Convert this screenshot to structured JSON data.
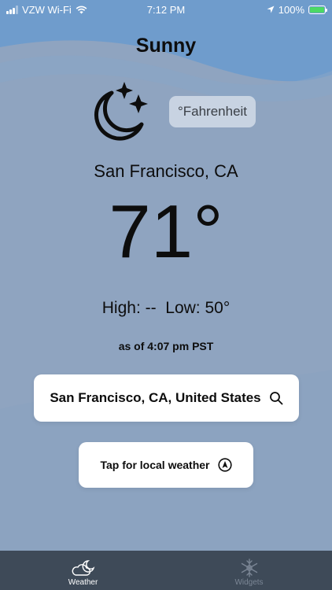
{
  "status_bar": {
    "carrier": "VZW Wi-Fi",
    "time": "7:12 PM",
    "battery": "100%"
  },
  "weather": {
    "condition": "Sunny",
    "unit_toggle": "°Fahrenheit",
    "city": "San Francisco, CA",
    "temperature": "71°",
    "high_low": "High: --  Low: 50°",
    "as_of": "as of 4:07 pm PST",
    "icon": "moon-stars-icon"
  },
  "search": {
    "location": "San Francisco, CA, United States",
    "icon": "search-icon"
  },
  "local_button": {
    "label": "Tap for local weather",
    "icon": "location-arrow-icon"
  },
  "tabs": [
    {
      "label": "Weather",
      "icon": "cloud-moon-icon",
      "active": true
    },
    {
      "label": "Widgets",
      "icon": "snowflake-icon",
      "active": false
    }
  ],
  "colors": {
    "background_top": "#6f9ccc",
    "background": "#8fa4c0",
    "tab_bar": "#3e4a58",
    "battery_fill": "#4cd964"
  }
}
